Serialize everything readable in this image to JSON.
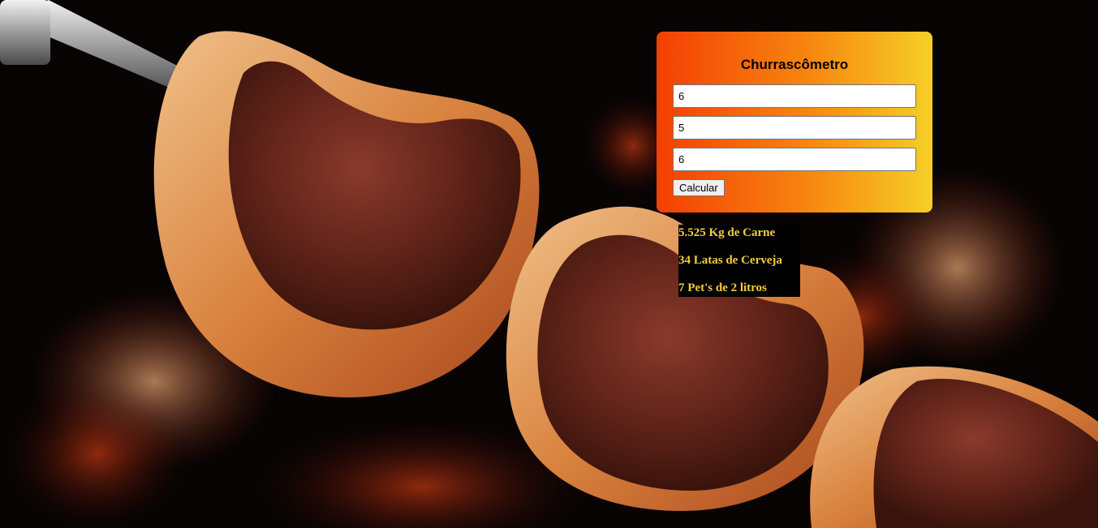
{
  "app": {
    "title": "Churrascômetro"
  },
  "form": {
    "inputs": [
      {
        "value": "6"
      },
      {
        "value": "5"
      },
      {
        "value": "6"
      }
    ],
    "calculate_label": "Calcular"
  },
  "results": {
    "meat": "5.525 Kg de Carne",
    "beer": "34 Latas de Cerveja",
    "soda": "7 Pet's de 2 litros"
  },
  "colors": {
    "card_gradient_start": "#f43f04",
    "card_gradient_end": "#f6cf27",
    "result_text": "#f4cd3c",
    "result_background": "#000000"
  },
  "background": {
    "icon": "barbecue-skewer-photo"
  }
}
